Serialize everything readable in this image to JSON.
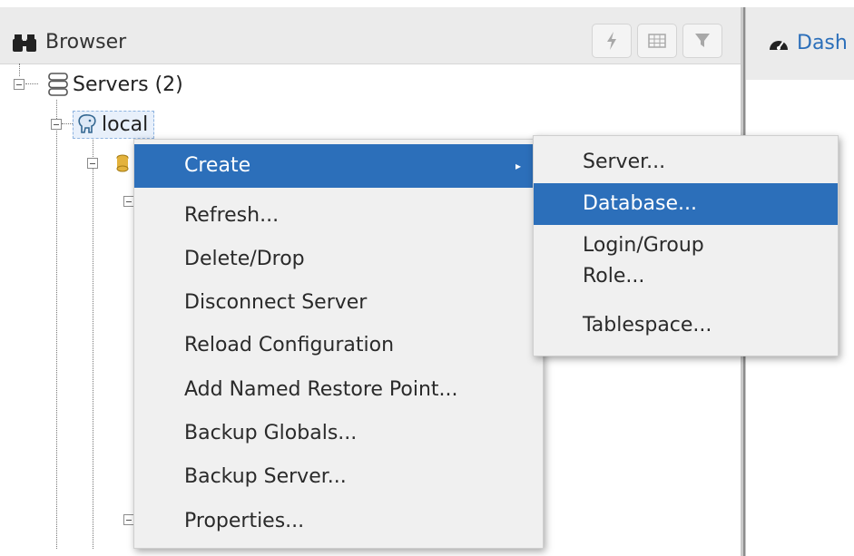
{
  "browser": {
    "title": "Browser",
    "toolbar": {
      "query_tool": "lightning-icon",
      "view_data": "grid-icon",
      "filter": "filter-icon"
    }
  },
  "dashboard": {
    "tab_label": "Dash"
  },
  "tree": {
    "servers_label": "Servers (2)",
    "local_label": "local"
  },
  "context_menu": {
    "items": [
      {
        "label": "Create",
        "active": true,
        "has_submenu": true
      },
      {
        "label": "Refresh..."
      },
      {
        "label": "Delete/Drop"
      },
      {
        "label": "Disconnect Server"
      },
      {
        "label": "Reload Configuration"
      },
      {
        "label": "Add Named Restore Point..."
      },
      {
        "label": "Backup Globals..."
      },
      {
        "label": "Backup Server..."
      },
      {
        "label": "Properties..."
      }
    ]
  },
  "create_submenu": {
    "items": [
      {
        "label": "Server..."
      },
      {
        "label": "Database...",
        "active": true
      },
      {
        "label": "Login/Group Role..."
      },
      {
        "label": "Tablespace..."
      }
    ]
  },
  "colors": {
    "accent": "#2c6fba",
    "menu_bg": "#f0f0f0",
    "header_bg": "#ebebeb"
  }
}
